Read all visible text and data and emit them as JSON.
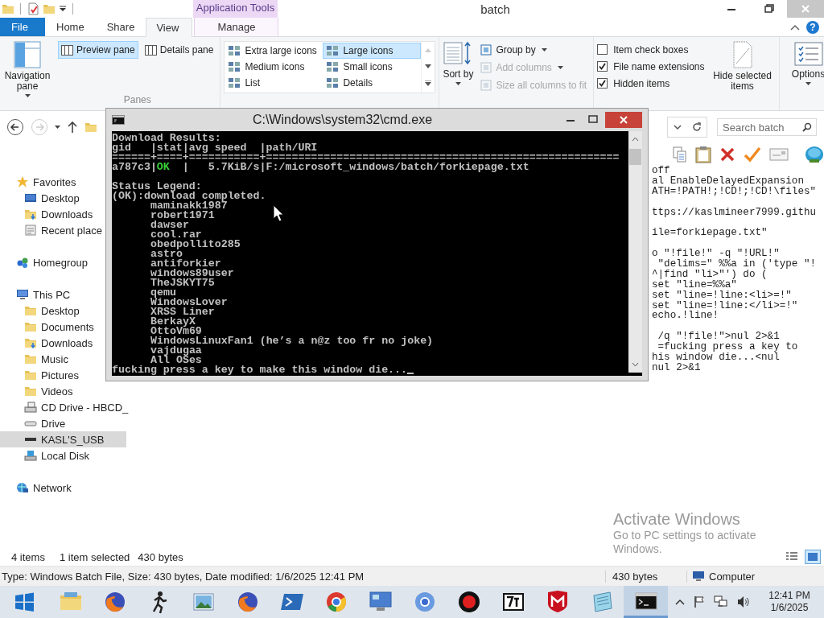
{
  "title_bar": {
    "title": "batch",
    "context_group": "Application Tools"
  },
  "ribbon_tabs": [
    {
      "label": "File",
      "kind": "file",
      "selected": false
    },
    {
      "label": "Home",
      "kind": "tab",
      "selected": false
    },
    {
      "label": "Share",
      "kind": "tab",
      "selected": false
    },
    {
      "label": "View",
      "kind": "tab",
      "selected": true
    },
    {
      "label": "Manage",
      "kind": "context",
      "selected": false
    }
  ],
  "help": "?",
  "ribbon": {
    "navigation_pane": "Navigation pane",
    "panes": {
      "label": "Panes",
      "items": [
        {
          "label": "Preview pane",
          "selected": true
        },
        {
          "label": "Details pane",
          "selected": false
        }
      ]
    },
    "layout": {
      "items": [
        {
          "label": "Extra large icons",
          "selected": false
        },
        {
          "label": "Large icons",
          "selected": true
        },
        {
          "label": "Medium icons",
          "selected": false
        },
        {
          "label": "Small icons",
          "selected": false
        },
        {
          "label": "List",
          "selected": false
        },
        {
          "label": "Details",
          "selected": false
        }
      ]
    },
    "current_view": {
      "sort_by": "Sort by",
      "items": [
        {
          "label": "Group by",
          "disabled": false
        },
        {
          "label": "Add columns",
          "disabled": true
        },
        {
          "label": "Size all columns to fit",
          "disabled": true
        }
      ]
    },
    "show_hide": {
      "checkboxes": [
        {
          "label": "Item check boxes",
          "checked": false
        },
        {
          "label": "File name extensions",
          "checked": true
        },
        {
          "label": "Hidden items",
          "checked": true
        }
      ],
      "hide_selected": "Hide selected items"
    },
    "options": "Options"
  },
  "search": {
    "placeholder": "Search batch"
  },
  "nav_tree": [
    {
      "label": "Favorites",
      "kind": "star",
      "selected": false,
      "children": [
        {
          "label": "Desktop",
          "kind": "desktop",
          "selected": false
        },
        {
          "label": "Downloads",
          "kind": "downloads",
          "selected": false
        },
        {
          "label": "Recent place",
          "kind": "recent",
          "selected": false
        }
      ]
    },
    {
      "label": "Homegroup",
      "kind": "homegroup",
      "selected": false
    },
    {
      "label": "This PC",
      "kind": "pc",
      "selected": false,
      "children": [
        {
          "label": "Desktop",
          "kind": "folder",
          "selected": false
        },
        {
          "label": "Documents",
          "kind": "folder",
          "selected": false
        },
        {
          "label": "Downloads",
          "kind": "downloads",
          "selected": false
        },
        {
          "label": "Music",
          "kind": "folder",
          "selected": false
        },
        {
          "label": "Pictures",
          "kind": "folder",
          "selected": false
        },
        {
          "label": "Videos",
          "kind": "folder",
          "selected": false
        },
        {
          "label": "CD Drive - HBCD_",
          "kind": "cd",
          "selected": false
        },
        {
          "label": "Drive",
          "kind": "drive",
          "selected": false
        },
        {
          "label": "KASL'S_USB",
          "kind": "usb",
          "selected": true
        },
        {
          "label": "Local Disk",
          "kind": "disk",
          "selected": false
        }
      ]
    },
    {
      "label": "Network",
      "kind": "network",
      "selected": false
    }
  ],
  "preview_lines": [
    {
      "kind": "code",
      "text": "off"
    },
    {
      "kind": "code",
      "text": "al EnableDelayedExpansion"
    },
    {
      "kind": "code",
      "text": "ATH=!PATH!;!CD!;!CD!\\files\""
    },
    {
      "kind": "blank"
    },
    {
      "kind": "code",
      "text": "ttps://kaslmineer7999.githu"
    },
    {
      "kind": "blank"
    },
    {
      "kind": "code",
      "text": "ile=forkiepage.txt\""
    },
    {
      "kind": "blank"
    },
    {
      "kind": "code",
      "text": "o \"!file!\" -q \"!URL!\""
    },
    {
      "kind": "code",
      "text": " \"delims=\" %%a in ('type \"!"
    },
    {
      "kind": "code",
      "text": "^|find \"li>\"') do ("
    },
    {
      "kind": "code",
      "text": "set \"line=%%a\""
    },
    {
      "kind": "code",
      "text": "set \"line=!line:<li>=!\""
    },
    {
      "kind": "code",
      "text": "set \"line=!line:</li>=!\""
    },
    {
      "kind": "code",
      "text": "echo.!line!"
    },
    {
      "kind": "blank"
    },
    {
      "kind": "code",
      "text": " /q \"!file!\">nul 2>&1"
    },
    {
      "kind": "code",
      "text": " =fucking press a key to"
    },
    {
      "kind": "code",
      "text": "his window die...<nul"
    },
    {
      "kind": "code",
      "text": "nul 2>&1"
    }
  ],
  "status_bar": {
    "items": "4 items",
    "selection": "1 item selected",
    "size": "430 bytes"
  },
  "details_bar": {
    "text": "Type: Windows Batch File, Size: 430 bytes, Date modified: 1/6/2025 12:41 PM",
    "size": "430 bytes",
    "zone": "Computer"
  },
  "activation": {
    "title": "Activate Windows",
    "message": "Go to PC settings to activate Windows."
  },
  "console": {
    "title": "C:\\Windows\\system32\\cmd.exe",
    "lines": [
      {
        "kind": "plain",
        "text": "Download Results:"
      },
      {
        "kind": "plain",
        "text": "gid   |stat|avg speed  |path/URI"
      },
      {
        "kind": "plain",
        "text": "======+====+===========+======================================================="
      },
      {
        "kind": "parts",
        "parts": [
          {
            "kind": "plain",
            "text": "a787c3|"
          },
          {
            "kind": "ok",
            "text": "OK"
          },
          {
            "kind": "plain",
            "text": "  |   5.7KiB/s|F:/microsoft_windows/batch/forkiepage.txt"
          }
        ]
      },
      {
        "kind": "blank"
      },
      {
        "kind": "plain",
        "text": "Status Legend:"
      },
      {
        "kind": "plain",
        "text": "(OK):download completed."
      },
      {
        "kind": "entry",
        "text": "maminakk1987"
      },
      {
        "kind": "entry",
        "text": "robert1971"
      },
      {
        "kind": "entry",
        "text": "dawser"
      },
      {
        "kind": "entry",
        "text": "cool.rar"
      },
      {
        "kind": "entry",
        "text": "obedpollito285"
      },
      {
        "kind": "entry",
        "text": "astro"
      },
      {
        "kind": "entry",
        "text": "antiforkier"
      },
      {
        "kind": "entry",
        "text": "windows89user"
      },
      {
        "kind": "entry",
        "text": "TheJSKYT75"
      },
      {
        "kind": "entry",
        "text": "qemu"
      },
      {
        "kind": "entry",
        "text": "WindowsLover"
      },
      {
        "kind": "entry",
        "text": "XRSS Liner"
      },
      {
        "kind": "entry",
        "text": "BerkayX"
      },
      {
        "kind": "entry",
        "text": "OttoVm69"
      },
      {
        "kind": "entry",
        "text": "WindowsLinuxFan1 (he’s a n@z too fr no joke)"
      },
      {
        "kind": "entry",
        "text": "vajdugaa"
      },
      {
        "kind": "entry",
        "text": "All OSes"
      },
      {
        "kind": "prompt",
        "text": "fucking press a key to make this window die..."
      }
    ]
  },
  "taskbar": {
    "apps": [
      {
        "kind": "explorer",
        "active": false
      },
      {
        "kind": "firefox",
        "active": false
      },
      {
        "kind": "figure",
        "active": false
      },
      {
        "kind": "photo",
        "active": false
      },
      {
        "kind": "firefox",
        "active": false
      },
      {
        "kind": "powershell",
        "active": false
      },
      {
        "kind": "chrome",
        "active": false
      },
      {
        "kind": "monitor",
        "active": false
      },
      {
        "kind": "bluecircle",
        "active": false
      },
      {
        "kind": "record",
        "active": false
      },
      {
        "kind": "sevenzip",
        "active": false
      },
      {
        "kind": "shield",
        "active": false
      },
      {
        "kind": "notepad",
        "active": false
      },
      {
        "kind": "cmd",
        "active": true
      }
    ],
    "clock": {
      "time": "12:41 PM",
      "date": "1/6/2025"
    }
  }
}
